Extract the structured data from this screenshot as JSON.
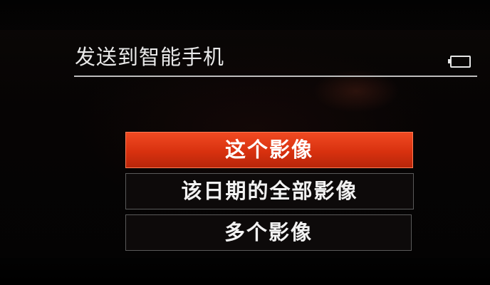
{
  "header": {
    "title": "发送到智能手机",
    "battery_icon": "battery-icon"
  },
  "menu": {
    "items": [
      {
        "label": "这个影像",
        "selected": true
      },
      {
        "label": "该日期的全部影像",
        "selected": false
      },
      {
        "label": "多个影像",
        "selected": false
      }
    ]
  },
  "colors": {
    "highlight": "#e03a15",
    "text": "#f2f2f2",
    "background": "#050303"
  }
}
